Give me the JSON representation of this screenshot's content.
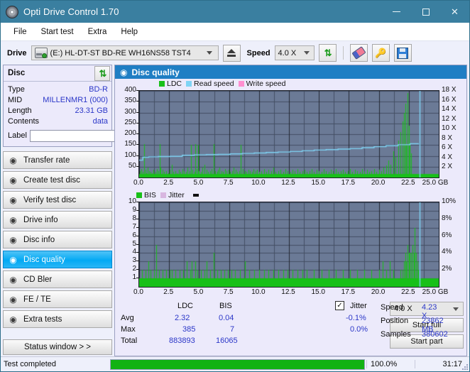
{
  "window": {
    "title": "Opti Drive Control 1.70",
    "icon": "disc-icon",
    "minimize": "—",
    "maximize": "☐",
    "close": "✕",
    "titlebar_color": "#3a7fa0"
  },
  "menu": {
    "items": [
      "File",
      "Start test",
      "Extra",
      "Help"
    ]
  },
  "toolbar": {
    "drive_label": "Drive",
    "drive_value": "(E:)  HL-DT-ST BD-RE  WH16NS58 TST4",
    "eject_icon": "eject-icon",
    "speed_label": "Speed",
    "speed_value": "4.0 X",
    "refresh_icon": "refresh-arrows-icon",
    "erase_icon": "eraser-icon",
    "keys_icon": "keys-icon",
    "save_icon": "floppy-save-icon"
  },
  "disc_panel": {
    "title": "Disc",
    "refresh_icon": "refresh-arrows-icon",
    "rows": [
      {
        "label": "Type",
        "value": "BD-R"
      },
      {
        "label": "MID",
        "value": "MILLENMR1 (000)"
      },
      {
        "label": "Length",
        "value": "23.31 GB"
      },
      {
        "label": "Contents",
        "value": "data"
      }
    ],
    "label_field_label": "Label",
    "label_field_value": "",
    "label_button_icon": "disc-icon"
  },
  "sidebar": {
    "items": [
      {
        "label": "Transfer rate",
        "icon": "disc-icon",
        "active": false
      },
      {
        "label": "Create test disc",
        "icon": "disc-icon",
        "active": false
      },
      {
        "label": "Verify test disc",
        "icon": "disc-icon",
        "active": false
      },
      {
        "label": "Drive info",
        "icon": "drive-icon",
        "active": false
      },
      {
        "label": "Disc info",
        "icon": "disc-icon",
        "active": false
      },
      {
        "label": "Disc quality",
        "icon": "disc-icon",
        "active": true
      },
      {
        "label": "CD Bler",
        "icon": "disc-icon",
        "active": false
      },
      {
        "label": "FE / TE",
        "icon": "disc-icon",
        "active": false
      },
      {
        "label": "Extra tests",
        "icon": "disc-icon",
        "active": false
      }
    ],
    "status_window_button": "Status window > >"
  },
  "main": {
    "header_title": "Disc quality",
    "header_icon": "disc-icon"
  },
  "stats": {
    "col_headers": [
      "LDC",
      "BIS"
    ],
    "row_labels": [
      "Avg",
      "Max",
      "Total"
    ],
    "ldc": {
      "avg": "2.32",
      "max": "385",
      "total": "883893"
    },
    "bis": {
      "avg": "0.04",
      "max": "7",
      "total": "16065"
    },
    "jitter": {
      "checkbox_label": "Jitter",
      "checked": true,
      "check_glyph": "✓",
      "avg": "-0.1%",
      "max": "0.0%"
    },
    "speed_label": "Speed",
    "speed_value": "4.23 X",
    "position_label": "Position",
    "position_value": "23862 MB",
    "samples_label": "Samples",
    "samples_value": "380602",
    "speed_select": "4.0 X",
    "start_full_button": "Start full",
    "start_part_button": "Start part"
  },
  "statusbar": {
    "message": "Test completed",
    "progress_percent_label": "100.0%",
    "progress_value": 100,
    "elapsed": "31:17"
  },
  "colors": {
    "ldc_green": "#18c018",
    "read_speed_blue": "#7fd4f5",
    "write_speed_pink": "#ff8fd0",
    "bis_green": "#18c018",
    "jitter_pink": "#d8b6e0",
    "plot_bg": "#6b7a96",
    "grid": "#4a5569",
    "accent": "#1f7ec4",
    "value_text": "#2b37c8"
  },
  "chart_data": [
    {
      "type": "bar",
      "id": "ldc-chart",
      "title": "",
      "legend": [
        {
          "name": "LDC",
          "color": "#18c018"
        },
        {
          "name": "Read speed",
          "color": "#7fd4f5"
        },
        {
          "name": "Write speed",
          "color": "#ff8fd0"
        }
      ],
      "legend_position": "top",
      "grid": true,
      "xlabel": "GB",
      "x_unit_label": "GB",
      "xlim": [
        0,
        25
      ],
      "xticks": [
        "0.0",
        "2.5",
        "5.0",
        "7.5",
        "10.0",
        "12.5",
        "15.0",
        "17.5",
        "20.0",
        "22.5",
        "25.0"
      ],
      "ylabel": "",
      "ylim": [
        0,
        400
      ],
      "yticks": [
        50,
        100,
        150,
        200,
        250,
        300,
        350,
        400
      ],
      "y2label": "",
      "y2lim": [
        0,
        18
      ],
      "y2ticks": [
        "2 X",
        "4 X",
        "6 X",
        "8 X",
        "10 X",
        "12 X",
        "14 X",
        "16 X",
        "18 X"
      ],
      "series": [
        {
          "name": "LDC",
          "color": "#18c018",
          "kind": "bar",
          "x": [
            0.05,
            0.18,
            0.3,
            0.42,
            0.55,
            0.62,
            0.7,
            0.85,
            0.95,
            1.05,
            1.2,
            1.35,
            1.5,
            1.62,
            1.72,
            1.8,
            1.95,
            2.1,
            2.25,
            2.4,
            2.55,
            2.7,
            2.85,
            3.0,
            3.15,
            3.3,
            3.45,
            3.6,
            3.75,
            3.9,
            4.05,
            4.2,
            4.3,
            4.45,
            4.6,
            4.7,
            4.8,
            4.9,
            5.0,
            5.15,
            5.3,
            5.45,
            5.6,
            5.75,
            5.9,
            6.05,
            6.2,
            6.35,
            6.5,
            6.6,
            6.7,
            6.85,
            7.0,
            7.15,
            7.3,
            7.45,
            7.6,
            7.75,
            7.9,
            8.05,
            8.2,
            8.35,
            8.5,
            8.65,
            8.8,
            8.95,
            9.1,
            9.25,
            9.4,
            9.55,
            9.7,
            9.85,
            10.0,
            10.2,
            10.4,
            10.6,
            10.8,
            11.0,
            11.2,
            11.4,
            11.6,
            11.8,
            12.0,
            12.2,
            12.4,
            12.6,
            12.8,
            13.0,
            13.2,
            13.4,
            13.6,
            13.8,
            14.0,
            14.2,
            14.4,
            14.6,
            14.8,
            15.0,
            15.2,
            15.4,
            15.6,
            15.8,
            16.0,
            16.2,
            16.4,
            16.6,
            16.8,
            17.0,
            17.2,
            17.4,
            17.6,
            17.8,
            18.0,
            18.2,
            18.4,
            18.6,
            18.8,
            19.0,
            19.2,
            19.4,
            19.6,
            19.8,
            20.0,
            20.2,
            20.4,
            20.6,
            20.8,
            21.0,
            21.2,
            21.4,
            21.6,
            21.8,
            22.0,
            22.1,
            22.2,
            22.3,
            22.4,
            22.5,
            22.6,
            22.7,
            22.8,
            22.9,
            23.0,
            23.1,
            23.2,
            23.3
          ],
          "values": [
            30,
            40,
            25,
            155,
            35,
            20,
            45,
            30,
            25,
            20,
            35,
            25,
            40,
            30,
            155,
            45,
            35,
            25,
            30,
            20,
            35,
            60,
            25,
            30,
            20,
            35,
            25,
            40,
            30,
            25,
            45,
            30,
            150,
            35,
            25,
            155,
            40,
            150,
            30,
            25,
            45,
            60,
            35,
            25,
            30,
            40,
            155,
            30,
            25,
            35,
            45,
            30,
            25,
            40,
            30,
            35,
            25,
            30,
            45,
            35,
            25,
            30,
            150,
            40,
            30,
            25,
            35,
            30,
            25,
            40,
            30,
            35,
            25,
            30,
            40,
            25,
            35,
            30,
            45,
            25,
            30,
            35,
            25,
            40,
            30,
            25,
            35,
            30,
            40,
            25,
            30,
            35,
            25,
            30,
            40,
            25,
            35,
            30,
            25,
            40,
            30,
            25,
            35,
            30,
            40,
            25,
            30,
            35,
            25,
            30,
            40,
            25,
            35,
            30,
            25,
            40,
            30,
            35,
            25,
            30,
            40,
            25,
            35,
            30,
            45,
            55,
            80,
            60,
            120,
            95,
            170,
            210,
            260,
            300,
            340,
            150,
            390,
            240,
            160,
            110
          ]
        },
        {
          "name": "Read speed",
          "color": "#7fd4f5",
          "kind": "line",
          "unit": "X",
          "x": [
            0.0,
            0.3,
            0.8,
            1.6,
            2.6,
            3.6,
            4.6,
            5.6,
            6.6,
            7.6,
            8.6,
            9.6,
            10.6,
            11.6,
            12.6,
            13.6,
            14.6,
            15.6,
            16.6,
            17.6,
            18.6,
            19.6,
            20.6,
            21.6,
            22.6,
            23.3
          ],
          "values": [
            3.6,
            4.2,
            4.3,
            4.35,
            4.4,
            4.6,
            4.7,
            4.75,
            4.8,
            4.9,
            5.0,
            5.1,
            5.2,
            5.3,
            5.4,
            5.55,
            5.7,
            5.8,
            5.9,
            6.0,
            6.2,
            6.4,
            6.6,
            6.8,
            7.0,
            7.1
          ]
        },
        {
          "name": "Write speed",
          "color": "#ff8fd0",
          "kind": "line",
          "x": [],
          "values": []
        }
      ],
      "markers": [
        {
          "type": "vline",
          "x": 23.38,
          "color": "#7fd4f5"
        }
      ]
    },
    {
      "type": "bar",
      "id": "bis-chart",
      "title": "",
      "legend": [
        {
          "name": "BIS",
          "color": "#18c018"
        },
        {
          "name": "Jitter",
          "color": "#d8b6e0"
        }
      ],
      "legend_position": "top",
      "grid": true,
      "xlabel": "GB",
      "x_unit_label": "GB",
      "xlim": [
        0,
        25
      ],
      "xticks": [
        "0.0",
        "2.5",
        "5.0",
        "7.5",
        "10.0",
        "12.5",
        "15.0",
        "17.5",
        "20.0",
        "22.5",
        "25.0"
      ],
      "ylabel": "",
      "ylim": [
        0,
        10
      ],
      "yticks": [
        1,
        2,
        3,
        4,
        5,
        6,
        7,
        8,
        9,
        10
      ],
      "y2label": "",
      "y2lim": [
        0,
        10
      ],
      "y2ticks": [
        "2%",
        "4%",
        "6%",
        "8%",
        "10%"
      ],
      "series": [
        {
          "name": "BIS",
          "color": "#18c018",
          "kind": "bar",
          "x": [
            0.05,
            0.15,
            0.25,
            0.35,
            0.45,
            0.55,
            0.65,
            0.75,
            0.85,
            0.95,
            1.05,
            1.15,
            1.25,
            1.35,
            1.45,
            1.55,
            1.65,
            1.75,
            1.85,
            1.95,
            2.05,
            2.15,
            2.25,
            2.35,
            2.45,
            2.55,
            2.65,
            2.75,
            2.85,
            2.95,
            3.05,
            3.2,
            3.35,
            3.5,
            3.65,
            3.8,
            3.95,
            4.1,
            4.25,
            4.4,
            4.55,
            4.7,
            4.85,
            5.0,
            5.15,
            5.3,
            5.45,
            5.6,
            5.75,
            5.9,
            6.05,
            6.2,
            6.35,
            6.5,
            6.65,
            6.8,
            6.95,
            7.1,
            7.25,
            7.4,
            7.55,
            7.7,
            7.85,
            8.0,
            8.2,
            8.4,
            8.6,
            8.8,
            9.0,
            9.2,
            9.4,
            9.6,
            9.8,
            10.0,
            10.2,
            10.4,
            10.6,
            10.8,
            11.0,
            11.2,
            11.4,
            11.6,
            11.8,
            12.0,
            12.2,
            12.4,
            12.6,
            12.8,
            13.0,
            13.2,
            13.4,
            13.6,
            13.8,
            14.0,
            14.3,
            14.6,
            14.9,
            15.2,
            15.5,
            15.8,
            16.1,
            16.4,
            16.7,
            17.0,
            17.3,
            17.6,
            17.9,
            18.2,
            18.5,
            18.8,
            19.1,
            19.4,
            19.7,
            20.0,
            20.3,
            20.6,
            20.9,
            21.2,
            21.5,
            21.8,
            22.0,
            22.1,
            22.2,
            22.3,
            22.4,
            22.5,
            22.6,
            22.7,
            22.8,
            22.9,
            23.0,
            23.1,
            23.2,
            23.3
          ],
          "values": [
            1,
            1,
            2,
            1,
            1,
            2,
            1,
            3,
            1,
            2,
            1,
            1,
            2,
            1,
            5,
            1,
            2,
            1,
            1,
            2,
            1,
            1,
            2,
            1,
            1,
            2,
            1,
            2,
            1,
            1,
            2,
            1,
            2,
            1,
            2,
            1,
            3,
            1,
            2,
            3,
            1,
            3,
            2,
            1,
            2,
            1,
            2,
            3,
            1,
            2,
            1,
            4,
            1,
            2,
            1,
            2,
            1,
            2,
            1,
            2,
            1,
            2,
            1,
            2,
            1,
            2,
            1,
            3,
            1,
            2,
            1,
            2,
            1,
            2,
            1,
            2,
            1,
            2,
            1,
            2,
            1,
            2,
            1,
            2,
            1,
            2,
            1,
            2,
            1,
            2,
            1,
            2,
            1,
            2,
            1,
            2,
            1,
            2,
            1,
            2,
            1,
            2,
            1,
            2,
            1,
            2,
            1,
            2,
            1,
            2,
            1,
            2,
            1,
            2,
            3,
            2,
            3,
            2,
            1,
            2,
            2,
            3,
            4,
            3,
            5,
            4,
            4,
            4,
            5,
            4,
            7,
            4,
            3,
            2
          ]
        },
        {
          "name": "Jitter",
          "color": "#d8b6e0",
          "kind": "line",
          "unit": "%",
          "x": [],
          "values": []
        }
      ],
      "markers": [
        {
          "type": "vline",
          "x": 23.38,
          "color": "#7fd4f5"
        }
      ]
    }
  ]
}
